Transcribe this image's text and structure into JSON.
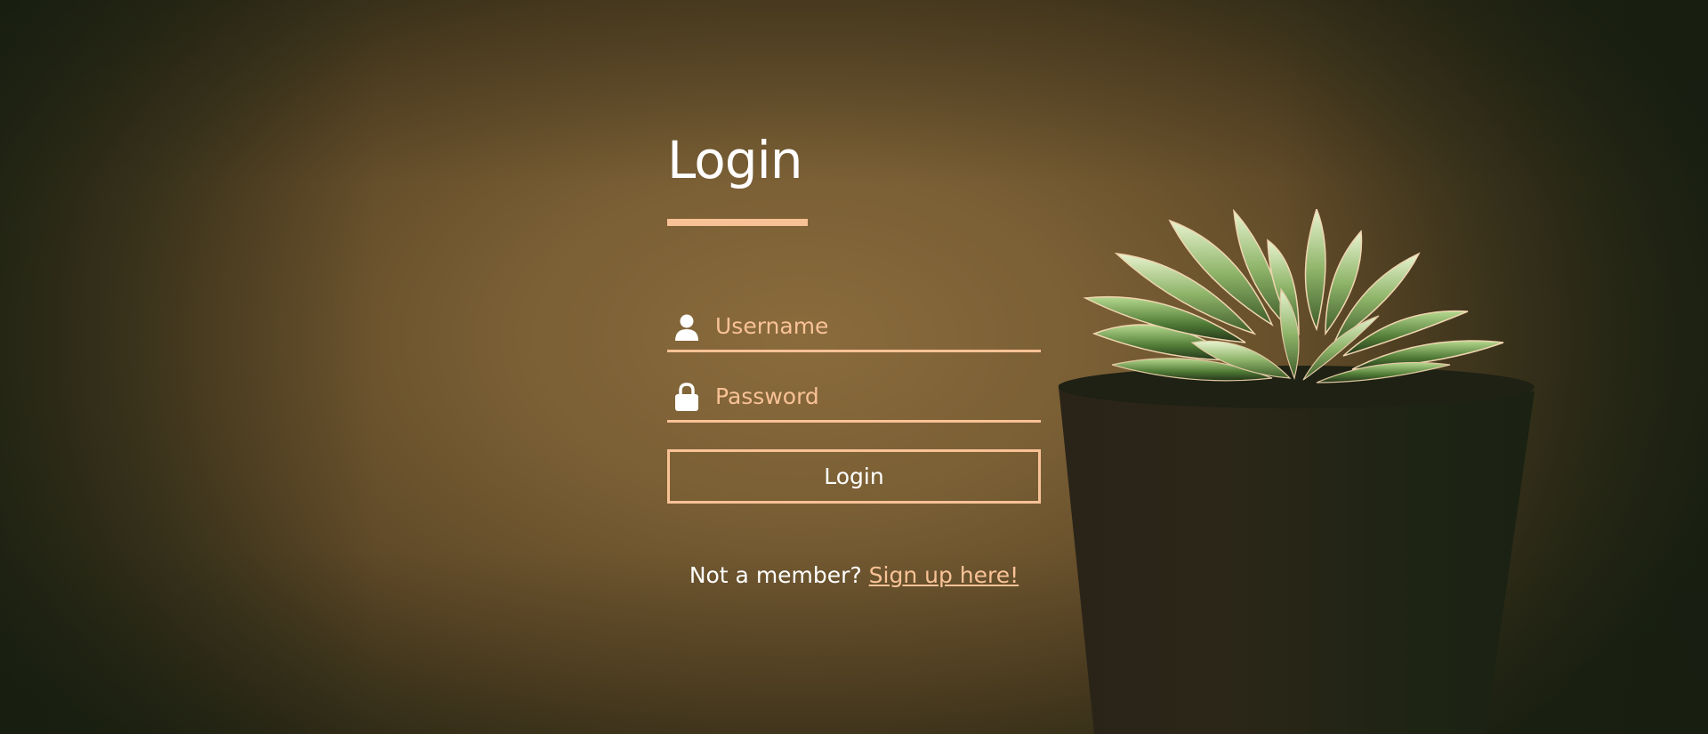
{
  "login": {
    "title": "Login",
    "username_placeholder": "Username",
    "password_placeholder": "Password",
    "button_label": "Login",
    "signup_prompt": "Not a member?",
    "signup_link": "Sign up here!"
  },
  "icons": {
    "username": "user-icon",
    "password": "lock-icon"
  },
  "colors": {
    "accent": "#f9c296",
    "text": "#ffffff"
  }
}
